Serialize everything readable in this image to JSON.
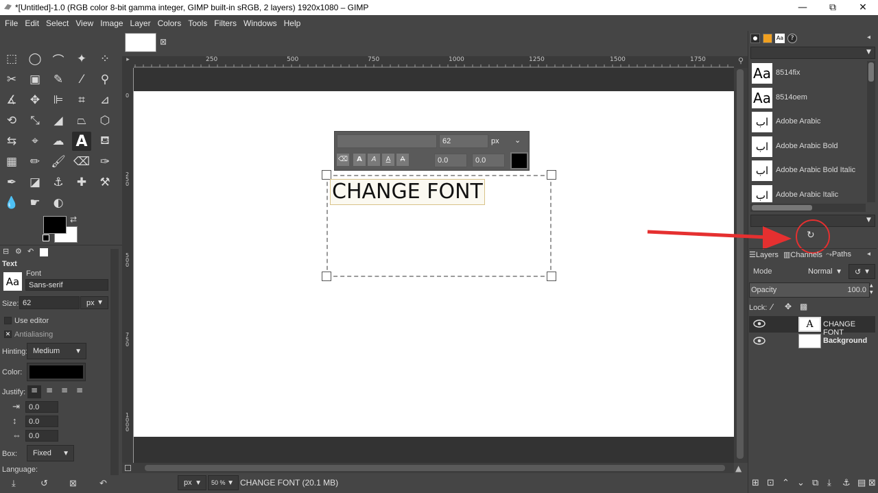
{
  "window": {
    "title": "*[Untitled]-1.0 (RGB color 8-bit gamma integer, GIMP built-in sRGB, 2 layers) 1920x1080 – GIMP",
    "minimize": "—",
    "maximize": "⧉",
    "close": "✕"
  },
  "menu": [
    "File",
    "Edit",
    "Select",
    "View",
    "Image",
    "Layer",
    "Colors",
    "Tools",
    "Filters",
    "Windows",
    "Help"
  ],
  "ruler_labels": [
    "250",
    "500",
    "750",
    "1000",
    "1250",
    "1500",
    "1750"
  ],
  "ruler_v_labels": [
    "0",
    "250",
    "500",
    "750",
    "1000"
  ],
  "tool_options": {
    "section": "Text",
    "font_label": "Font",
    "font_value": "Sans-serif",
    "aa_glyph": "Aa",
    "size_label": "Size:",
    "size_value": "62",
    "size_unit": "px",
    "use_editor": "Use editor",
    "antialiasing": "Antialiasing",
    "hinting_label": "Hinting:",
    "hinting_value": "Medium",
    "color_label": "Color:",
    "justify_label": "Justify:",
    "indent": "0.0",
    "line_spacing": "0.0",
    "letter_spacing": "0.0",
    "box_label": "Box:",
    "box_value": "Fixed",
    "language_label": "Language:"
  },
  "text_toolbar": {
    "size": "62",
    "unit": "px",
    "baseline": "0.0",
    "kerning": "0.0"
  },
  "canvas_text": "CHANGE FONT",
  "status": {
    "unit": "px",
    "zoom": "50 %",
    "message": "CHANGE FONT (20.1 MB)"
  },
  "fonts": [
    {
      "glyph": "Aa",
      "name": "8514fix"
    },
    {
      "glyph": "Aa",
      "name": "8514oem"
    },
    {
      "glyph": "اب",
      "name": "Adobe Arabic"
    },
    {
      "glyph": "اب",
      "name": "Adobe Arabic Bold"
    },
    {
      "glyph": "اب",
      "name": "Adobe Arabic Bold Italic"
    },
    {
      "glyph": "اب",
      "name": "Adobe Arabic Italic"
    }
  ],
  "layers_panel": {
    "tabs": [
      "Layers",
      "Channels",
      "Paths"
    ],
    "mode_label": "Mode",
    "mode_value": "Normal",
    "opacity_label": "Opacity",
    "opacity_value": "100.0",
    "lock_label": "Lock:",
    "layers": [
      {
        "name": "CHANGE FONT"
      },
      {
        "name": "Background"
      }
    ]
  },
  "colors": {
    "accent_arrow": "#e53030",
    "panel_bg": "#454545"
  }
}
